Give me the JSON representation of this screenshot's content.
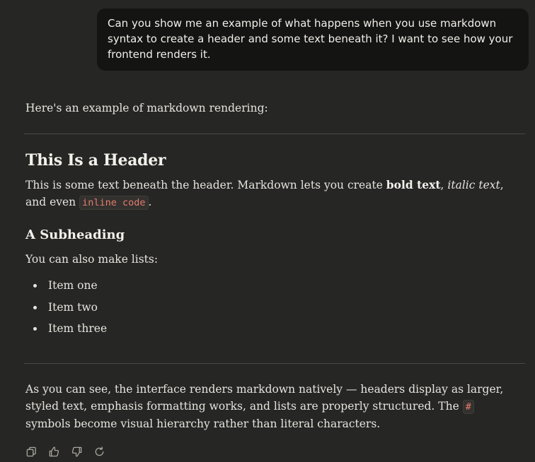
{
  "user_message": {
    "text": "Can you show me an example of what happens when you use markdown syntax to create a header and some text beneath it? I want to see how your frontend renders it."
  },
  "assistant_message": {
    "intro": "Here's an example of markdown rendering:",
    "header": "This Is a Header",
    "paragraph": {
      "before_bold": "This is some text beneath the header. Markdown lets you create ",
      "bold": "bold text",
      "between_1": ", ",
      "italic": "italic text",
      "between_2": ", and even ",
      "code": "inline code",
      "end": "."
    },
    "subheading": "A Subheading",
    "lists_intro": "You can also make lists:",
    "list_items": [
      "Item one",
      "Item two",
      "Item three"
    ],
    "closing": {
      "before_code": "As you can see, the interface renders markdown natively — headers display as larger, styled text, emphasis formatting works, and lists are properly structured. The ",
      "code": "#",
      "after_code": " symbols become visual hierarchy rather than literal characters."
    }
  },
  "actions": [
    {
      "name": "copy",
      "icon": "copy-icon"
    },
    {
      "name": "thumbs-up",
      "icon": "thumbs-up-icon"
    },
    {
      "name": "thumbs-down",
      "icon": "thumbs-down-icon"
    },
    {
      "name": "retry",
      "icon": "retry-icon"
    }
  ],
  "colors": {
    "background": "#262624",
    "user_bubble": "#141413",
    "text": "#e6e4df",
    "inline_code": "#e57c6e"
  }
}
